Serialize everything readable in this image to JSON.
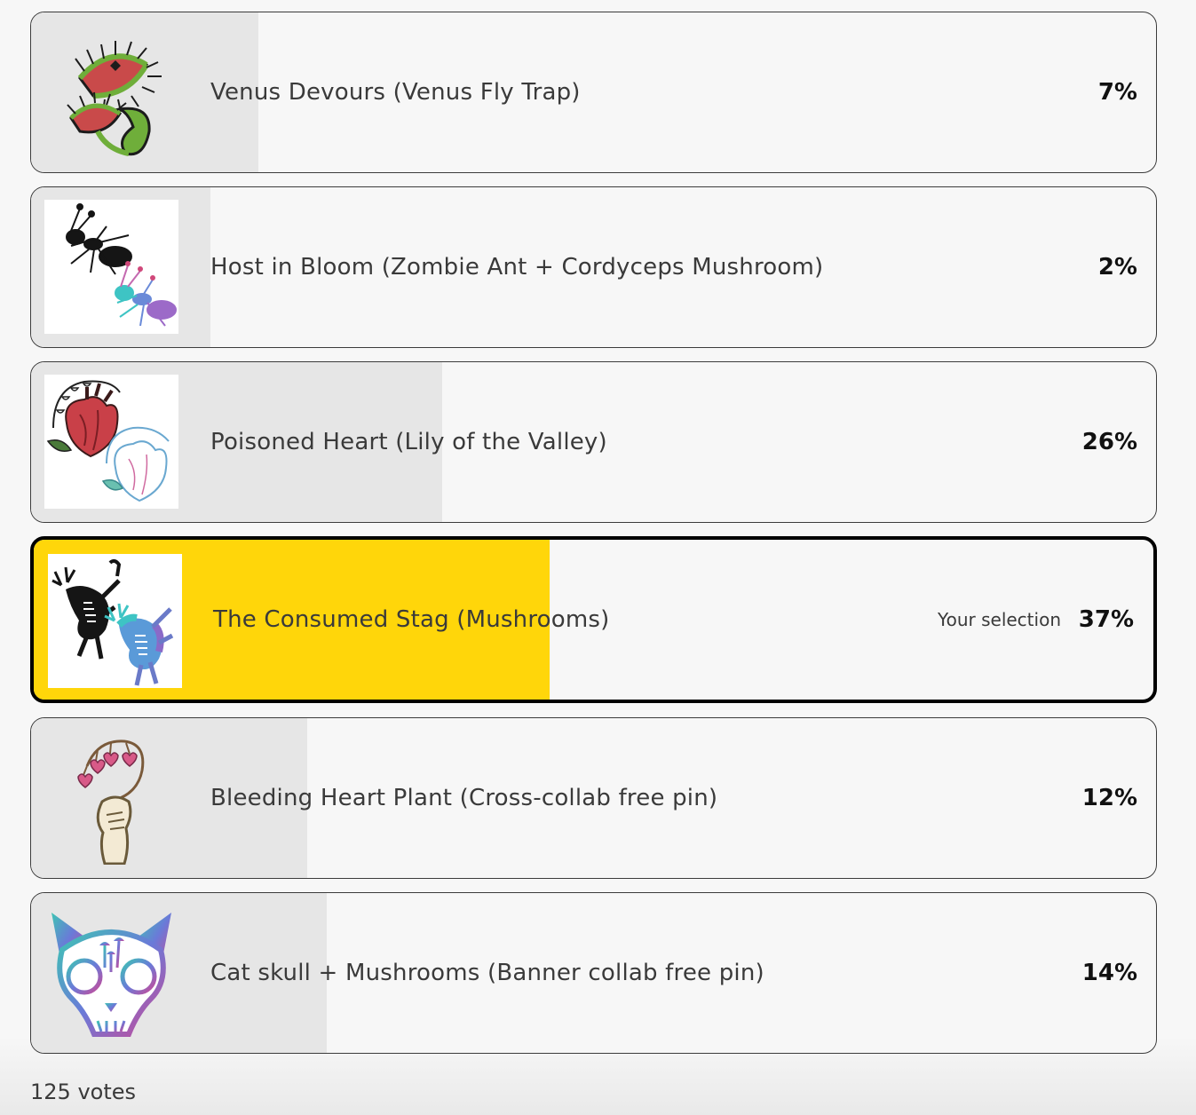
{
  "poll": {
    "options": [
      {
        "label": "Venus Devours (Venus Fly Trap)",
        "percent_text": "7%",
        "percent": 0.07,
        "icon": "venus-fly-trap-icon",
        "selected": false
      },
      {
        "label": "Host in Bloom (Zombie Ant + Cordyceps Mushroom)",
        "percent_text": "2%",
        "percent": 0.02,
        "icon": "zombie-ant-icon",
        "selected": false
      },
      {
        "label": "Poisoned Heart (Lily of the Valley)",
        "percent_text": "26%",
        "percent": 0.26,
        "icon": "poisoned-heart-icon",
        "selected": false
      },
      {
        "label": "The Consumed Stag (Mushrooms)",
        "percent_text": "37%",
        "percent": 0.37,
        "icon": "consumed-stag-icon",
        "selected": true,
        "selection_note": "Your selection"
      },
      {
        "label": "Bleeding Heart Plant (Cross-collab free pin)",
        "percent_text": "12%",
        "percent": 0.12,
        "icon": "bleeding-heart-icon",
        "selected": false
      },
      {
        "label": "Cat skull + Mushrooms (Banner collab free pin)",
        "percent_text": "14%",
        "percent": 0.14,
        "icon": "cat-skull-icon",
        "selected": false
      }
    ],
    "votes_text": "125 votes"
  },
  "colors": {
    "selected_fill": "#ffd60a",
    "result_fill": "#e6e6e6",
    "background": "#f7f7f7"
  }
}
